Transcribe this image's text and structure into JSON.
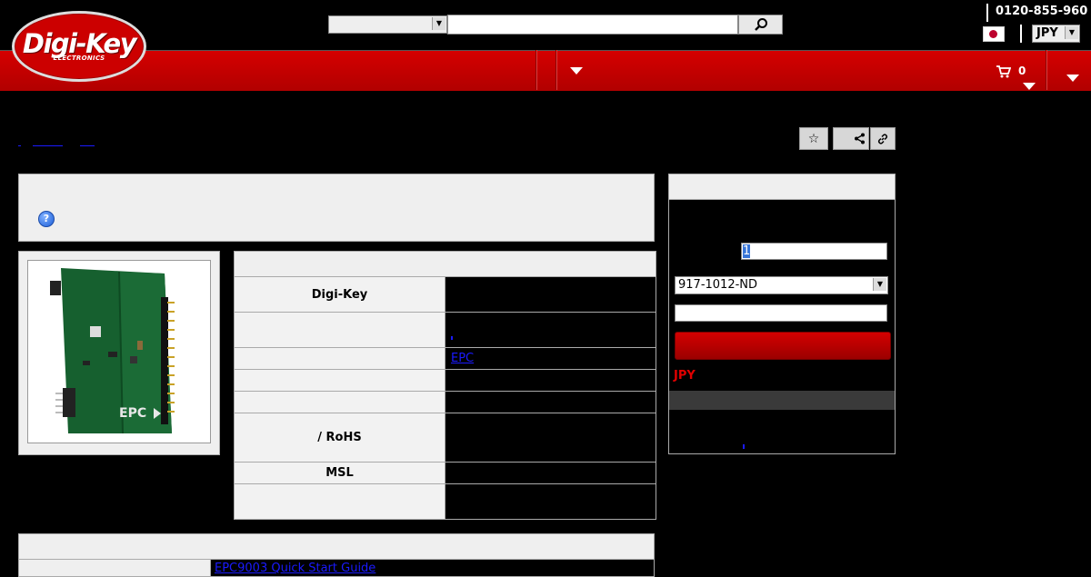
{
  "header": {
    "logo_text": "Digi-Key",
    "logo_subtext": "ELECTRONICS",
    "search_category": "",
    "search_placeholder": "",
    "phone": "0120-855-960",
    "currency": "JPY",
    "cart_count": "0"
  },
  "attributes": {
    "rows": [
      {
        "key": "Digi-Key",
        "value": ""
      },
      {
        "key": "",
        "value": ""
      },
      {
        "key": "",
        "value": "EPC"
      },
      {
        "key": "",
        "value": ""
      },
      {
        "key": "",
        "value": ""
      },
      {
        "key": "/ RoHS",
        "value": ""
      },
      {
        "key": "MSL",
        "value": ""
      },
      {
        "key": "",
        "value": ""
      }
    ]
  },
  "pricing": {
    "quantity": "1",
    "part_number": "917-1012-ND",
    "currency_note": "JPY"
  },
  "documents": {
    "quick_start_link": "EPC9003 Quick Start Guide"
  },
  "colors": {
    "brand_red": "#cc0000",
    "link_blue": "#1a1aff",
    "panel_grey": "#efefef"
  },
  "icons": [
    "search-icon",
    "star-icon",
    "share-icon",
    "link-icon",
    "cart-icon",
    "help-icon",
    "japan-flag-icon"
  ]
}
